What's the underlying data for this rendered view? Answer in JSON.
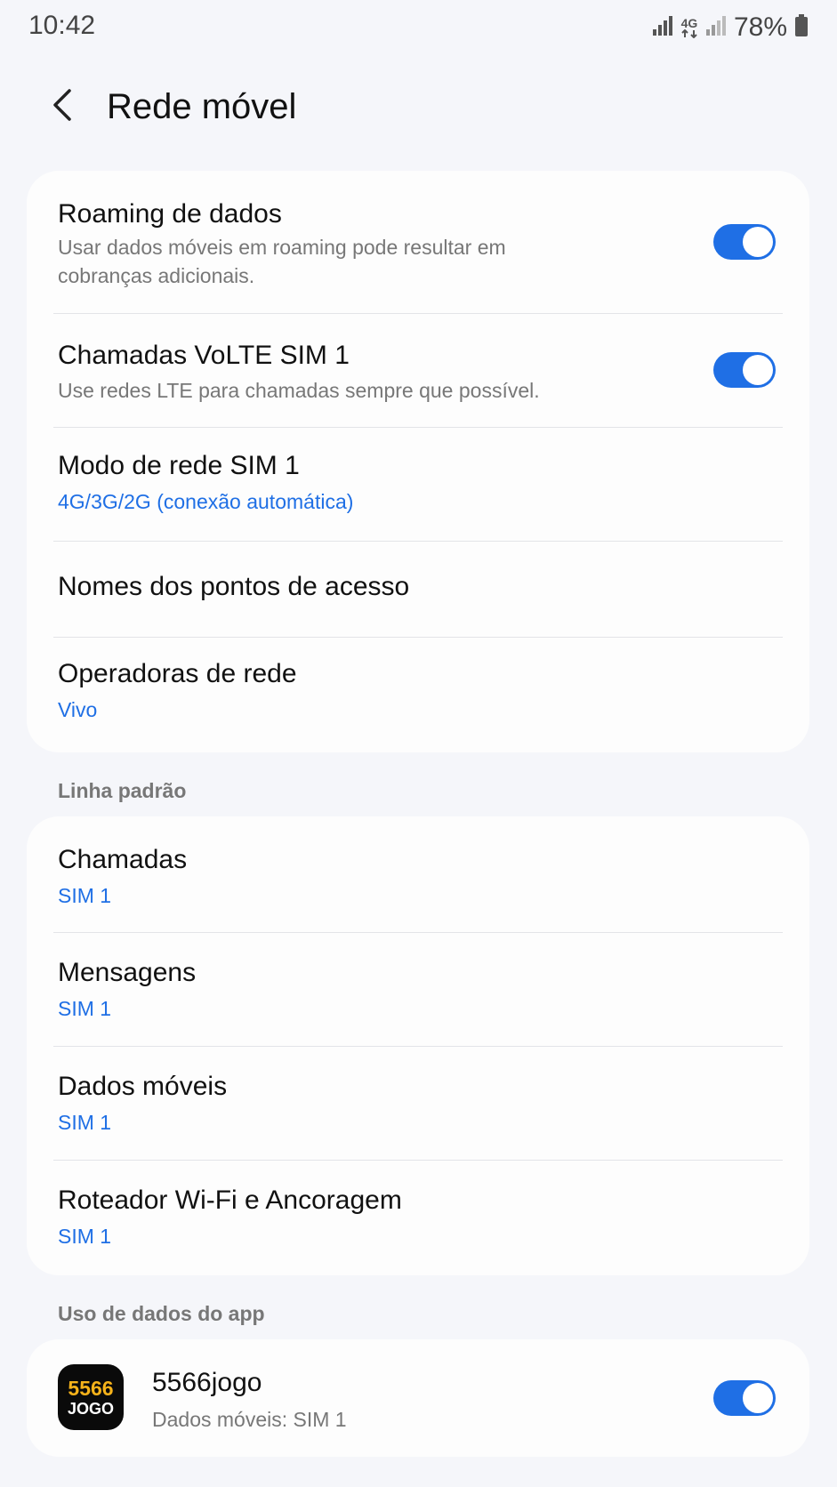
{
  "status_bar": {
    "time": "10:42",
    "network_type": "4G",
    "battery": "78%",
    "icons": [
      "signal-sim1-icon",
      "4g-data-icon",
      "signal-sim2-icon",
      "battery-icon"
    ]
  },
  "header": {
    "title": "Rede móvel",
    "back_icon": "chevron-left-icon"
  },
  "card_main": {
    "roaming": {
      "title": "Roaming de dados",
      "subtitle": "Usar dados móveis em roaming pode resultar em cobranças adicionais.",
      "toggle_on": true
    },
    "volte": {
      "title": "Chamadas VoLTE SIM 1",
      "subtitle": "Use redes LTE para chamadas sempre que possível.",
      "toggle_on": true
    },
    "network_mode": {
      "title": "Modo de rede SIM 1",
      "value": "4G/3G/2G (conexão automática)"
    },
    "apn": {
      "title": "Nomes dos pontos de acesso"
    },
    "operators": {
      "title": "Operadoras de rede",
      "value": "Vivo"
    }
  },
  "default_line": {
    "section_label": "Linha padrão",
    "calls": {
      "title": "Chamadas",
      "value": "SIM 1"
    },
    "messages": {
      "title": "Mensagens",
      "value": "SIM 1"
    },
    "mobile_data": {
      "title": "Dados móveis",
      "value": "SIM 1"
    },
    "hotspot": {
      "title": "Roteador Wi-Fi e Ancoragem",
      "value": "SIM 1"
    }
  },
  "app_data": {
    "section_label": "Uso de dados do app",
    "app": {
      "icon_top": "5566",
      "icon_bottom": "JOGO",
      "name": "5566jogo",
      "subtitle": "Dados móveis: SIM 1",
      "toggle_on": true
    }
  },
  "colors": {
    "accent": "#1f6fe5",
    "background": "#f5f6fa",
    "card": "#fdfdfd",
    "secondary_text": "#777777"
  }
}
